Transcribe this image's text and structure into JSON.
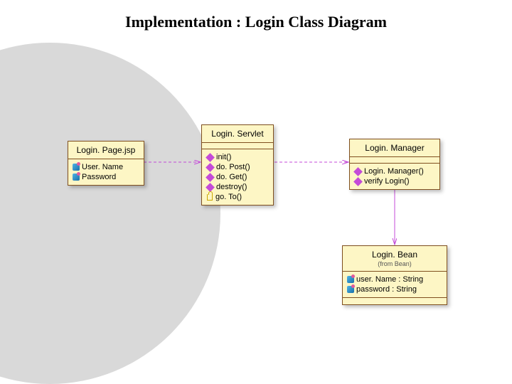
{
  "title": "Implementation : Login Class Diagram",
  "classes": {
    "loginPage": {
      "name": "Login. Page.jsp",
      "attributes": [
        "User. Name",
        "Password"
      ]
    },
    "loginServlet": {
      "name": "Login. Servlet",
      "operations": [
        "init()",
        "do. Post()",
        "do. Get()",
        "destroy()",
        "go. To()"
      ]
    },
    "loginManager": {
      "name": "Login. Manager",
      "operations": [
        "Login. Manager()",
        "verify Login()"
      ]
    },
    "loginBean": {
      "name": "Login. Bean",
      "from": "(from Bean)",
      "attributes": [
        "user. Name : String",
        "password : String"
      ]
    }
  },
  "relations": [
    {
      "from": "loginPage",
      "to": "loginServlet",
      "style": "dashed"
    },
    {
      "from": "loginServlet",
      "to": "loginManager",
      "style": "dashed"
    },
    {
      "from": "loginManager",
      "to": "loginBean",
      "style": "solid"
    }
  ]
}
